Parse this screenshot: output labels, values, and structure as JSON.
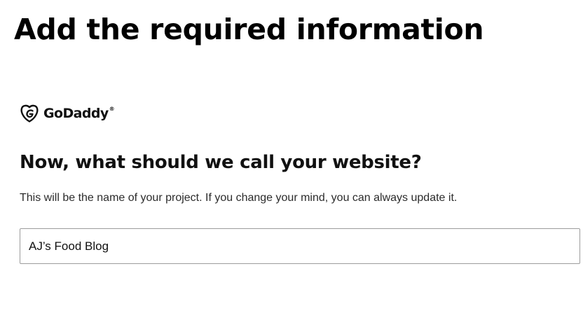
{
  "page": {
    "heading": "Add the required information"
  },
  "brand": {
    "icon": "godaddy-logo-icon",
    "name": "GoDaddy",
    "trademark": "®"
  },
  "form": {
    "question": "Now, what should we call your website?",
    "helper": "This will be the name of your project. If you change your mind, you can always update it.",
    "site_name_value": "AJ’s Food Blog"
  },
  "colors": {
    "text_primary": "#111111",
    "field_border": "#9c9c9c"
  }
}
